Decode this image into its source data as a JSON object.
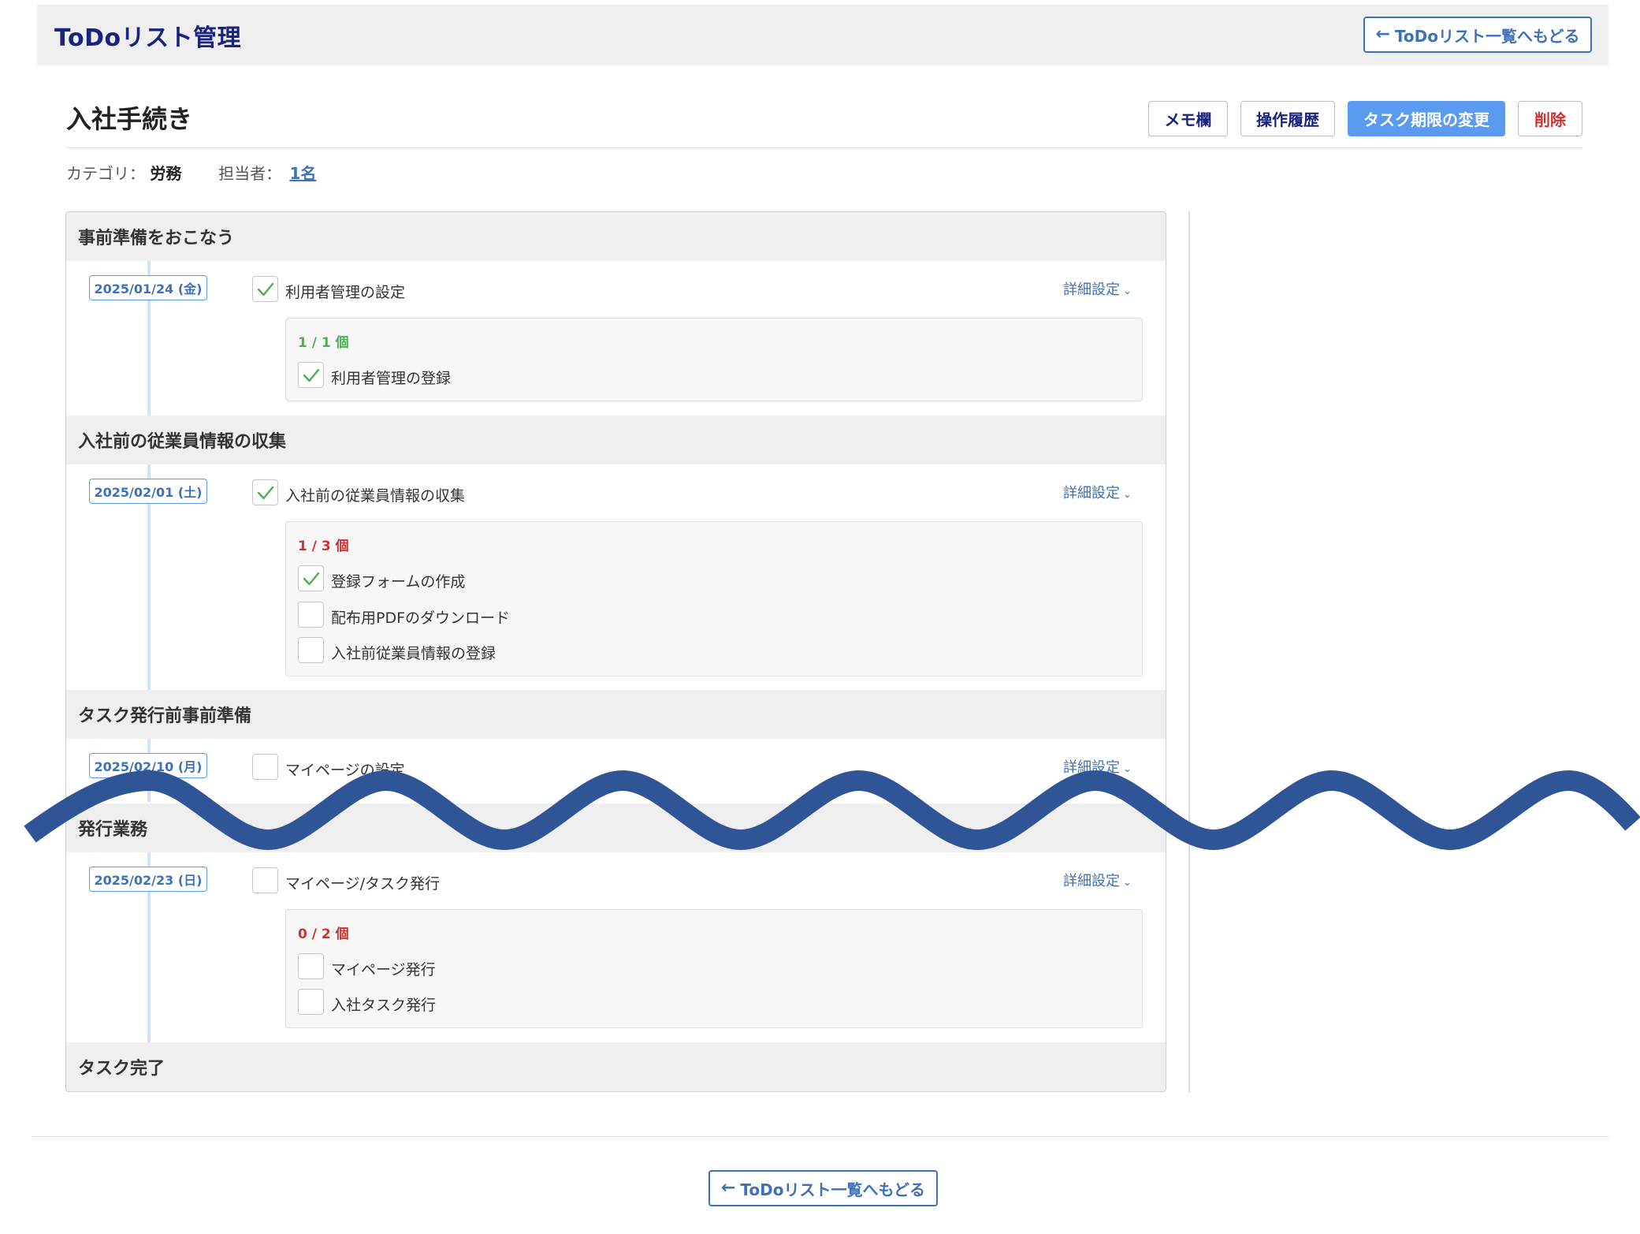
{
  "header": {
    "app_title": "ToDoリスト管理",
    "back_label": "ToDoリスト一覧へもどる"
  },
  "page": {
    "title": "入社手続き",
    "actions": {
      "memo": "メモ欄",
      "history": "操作履歴",
      "deadline": "タスク期限の変更",
      "delete": "削除"
    },
    "meta": {
      "category_label": "カテゴリ：",
      "category_value": "労務",
      "assignee_label": "担当者：",
      "assignee_value": "1名"
    }
  },
  "detail_label": "詳細設定",
  "sections": [
    {
      "title": "事前準備をおこなう",
      "task": {
        "date": "2025/01/24 (金)",
        "label": "利用者管理の設定",
        "checked": true,
        "counter": "1 / 1 個",
        "subtasks": [
          {
            "label": "利用者管理の登録",
            "checked": true
          }
        ]
      }
    },
    {
      "title": "入社前の従業員情報の収集",
      "task": {
        "date": "2025/02/01 (土)",
        "label": "入社前の従業員情報の収集",
        "checked": true,
        "counter": "1 / 3 個",
        "subtasks": [
          {
            "label": "登録フォームの作成",
            "checked": true
          },
          {
            "label": "配布用PDFのダウンロード",
            "checked": false
          },
          {
            "label": "入社前従業員情報の登録",
            "checked": false
          }
        ]
      }
    },
    {
      "title": "タスク発行前事前準備",
      "task": {
        "date": "2025/02/10 (月)",
        "label": "マイページの設定",
        "checked": false
      }
    },
    {
      "title": "発行業務",
      "task": {
        "date": "2025/02/23 (日)",
        "label": "マイページ/タスク発行",
        "checked": false,
        "counter": "0 / 2 個",
        "subtasks": [
          {
            "label": "マイページ発行",
            "checked": false
          },
          {
            "label": "入社タスク発行",
            "checked": false
          }
        ]
      }
    },
    {
      "title": "タスク完了"
    }
  ],
  "colors": {
    "accent": "#3f71b8",
    "primary_button": "#5b9bef",
    "danger": "#d32f2f",
    "success": "#4caf50",
    "wave": "#2f5597"
  }
}
